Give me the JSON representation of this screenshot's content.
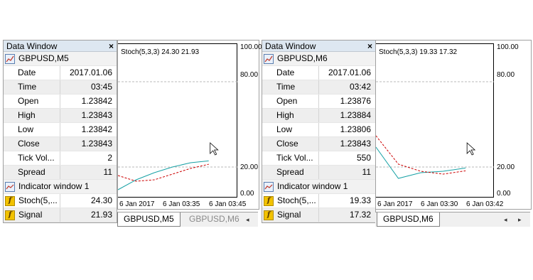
{
  "panels": [
    {
      "title": "Data Window",
      "close": "×",
      "symbol": "GBPUSD,M5",
      "rows": [
        {
          "k": "Date",
          "v": "2017.01.06"
        },
        {
          "k": "Time",
          "v": "03:45"
        },
        {
          "k": "Open",
          "v": "1.23842"
        },
        {
          "k": "High",
          "v": "1.23843"
        },
        {
          "k": "Low",
          "v": "1.23842"
        },
        {
          "k": "Close",
          "v": "1.23843"
        },
        {
          "k": "Tick Vol...",
          "v": "2"
        },
        {
          "k": "Spread",
          "v": "11"
        }
      ],
      "indicator_window": "Indicator window 1",
      "ind_rows": [
        {
          "k": "Stoch(5,...",
          "v": "24.30"
        },
        {
          "k": "Signal",
          "v": "21.93"
        }
      ]
    },
    {
      "title": "Data Window",
      "close": "×",
      "symbol": "GBPUSD,M6",
      "rows": [
        {
          "k": "Date",
          "v": "2017.01.06"
        },
        {
          "k": "Time",
          "v": "03:42"
        },
        {
          "k": "Open",
          "v": "1.23876"
        },
        {
          "k": "High",
          "v": "1.23884"
        },
        {
          "k": "Low",
          "v": "1.23806"
        },
        {
          "k": "Close",
          "v": "1.23843"
        },
        {
          "k": "Tick Vol...",
          "v": "550"
        },
        {
          "k": "Spread",
          "v": "11"
        }
      ],
      "indicator_window": "Indicator window 1",
      "ind_rows": [
        {
          "k": "Stoch(5,...",
          "v": "19.33"
        },
        {
          "k": "Signal",
          "v": "17.32"
        }
      ]
    }
  ],
  "charts": [
    {
      "label": "Stoch(5,3,3) 24.30 21.93",
      "y_labels": [
        "100.00",
        "80.00",
        "20.00",
        "0.00"
      ],
      "x_labels": [
        "6 Jan 2017",
        "6 Jan 03:35",
        "6 Jan 03:45"
      ],
      "tabs": [
        {
          "label": "GBPUSD,M5",
          "active": true
        },
        {
          "label": "GBPUSD,M6",
          "active": false
        }
      ],
      "arrows": [
        "◂"
      ]
    },
    {
      "label": "Stoch(5,3,3) 19.33 17.32",
      "y_labels": [
        "100.00",
        "80.00",
        "20.00",
        "0.00"
      ],
      "x_labels": [
        "6 Jan 2017",
        "6 Jan 03:30",
        "6 Jan 03:42"
      ],
      "tabs": [
        {
          "label": "GBPUSD,M6",
          "active": true
        }
      ],
      "arrows": [
        "◂",
        "▸"
      ]
    }
  ],
  "chart_data": [
    {
      "type": "line",
      "title": "Stoch(5,3,3) 24.30 21.93",
      "ylim": [
        0,
        100
      ],
      "levels": [
        80,
        20
      ],
      "x": [
        0,
        1,
        2,
        3,
        4,
        5
      ],
      "series": [
        {
          "values": [
            4,
            11,
            16,
            20,
            23,
            24.3
          ],
          "color": "#17a1a5",
          "style": "solid"
        },
        {
          "values": [
            14,
            10,
            11,
            15,
            19,
            21.93
          ],
          "color": "#cc0000",
          "style": "dashed"
        }
      ]
    },
    {
      "type": "line",
      "title": "Stoch(5,3,3) 19.33 17.32",
      "ylim": [
        0,
        100
      ],
      "levels": [
        80,
        20
      ],
      "x": [
        0,
        1,
        2,
        3,
        4
      ],
      "series": [
        {
          "values": [
            34,
            12,
            16,
            17,
            19.33
          ],
          "color": "#17a1a5",
          "style": "solid"
        },
        {
          "values": [
            42,
            22,
            17,
            15,
            17.32
          ],
          "color": "#cc0000",
          "style": "dashed"
        }
      ]
    }
  ]
}
